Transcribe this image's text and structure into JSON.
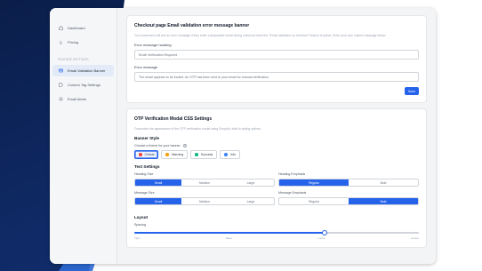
{
  "sidebar": {
    "items": [
      {
        "label": "Dashboard",
        "icon": "home-icon"
      },
      {
        "label": "Pricing",
        "icon": "dollar-icon"
      }
    ],
    "section_title": "Feature Settings",
    "feature_items": [
      {
        "label": "Email Validation Banner",
        "icon": "mail-icon",
        "active": true
      },
      {
        "label": "Custom Tag Settings",
        "icon": "tag-icon",
        "active": false
      },
      {
        "label": "Email Alerts",
        "icon": "bell-icon",
        "active": false
      }
    ]
  },
  "banner_card": {
    "title": "Checkout page Email validation error message banner",
    "description": "Your customers will see an error message if they enter a disposable email during checkout when the \"Email validation on checkout\" feature is active. Enter your own custom message below.",
    "heading_label": "Error message heading",
    "heading_value": "Email Verification Required",
    "message_label": "Error message",
    "message_value": "The email appears to be invalid. An OTP has been sent to your email for manual verification.",
    "save_label": "Save"
  },
  "otp_card": {
    "title": "OTP Verification Modal CSS Settings",
    "description": "Customize the appearance of the OTP verification modal using Shopify's built-in styling options.",
    "banner_style": {
      "heading": "Banner Style",
      "choose_label": "Choose a theme for your banner",
      "themes": [
        {
          "label": "Critical",
          "color": "#ef4444",
          "selected": true
        },
        {
          "label": "Warning",
          "color": "#f59e0b",
          "selected": false
        },
        {
          "label": "Success",
          "color": "#10b981",
          "selected": false
        },
        {
          "label": "Info",
          "color": "#3b82f6",
          "selected": false
        }
      ]
    },
    "text_settings": {
      "heading": "Text Settings",
      "heading_size": {
        "label": "Heading Size",
        "options": [
          "Small",
          "Medium",
          "Large"
        ],
        "selected": "Small"
      },
      "heading_emphasis": {
        "label": "Heading Emphasis",
        "options": [
          "Regular",
          "Bold"
        ],
        "selected": "Regular"
      },
      "message_size": {
        "label": "Message Size",
        "options": [
          "Small",
          "Medium",
          "Large"
        ],
        "selected": "Small"
      },
      "message_emphasis": {
        "label": "Message Emphasis",
        "options": [
          "Regular",
          "Bold"
        ],
        "selected": "Bold"
      }
    },
    "layout": {
      "heading": "Layout",
      "spacing_label": "Spacing",
      "spacing_ticks": [
        "Tight",
        "Base",
        "Loose",
        "Looser"
      ],
      "spacing_value_fraction": 0.67
    }
  },
  "colors": {
    "accent": "#2563eb",
    "background_navy": "#0f2a66"
  }
}
